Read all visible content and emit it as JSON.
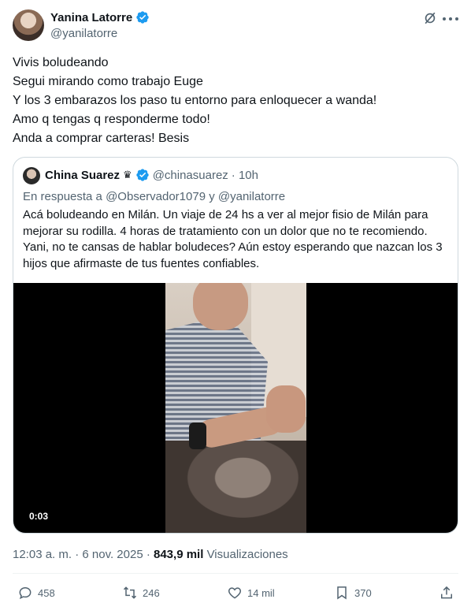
{
  "author": {
    "name": "Yanina Latorre",
    "handle": "@yanilatorre"
  },
  "tweet": {
    "lines": [
      "Vivis boludeando",
      "Segui mirando como trabajo Euge",
      "Y los 3 embarazos los paso tu entorno para enloquecer a wanda!",
      "Amo q tengas q responderme todo!",
      "Anda a comprar carteras! Besis"
    ]
  },
  "quote": {
    "name": "China Suarez",
    "crown": "♛",
    "handle": "@chinasuarez",
    "time": "· 10h",
    "reply_prefix": "En respuesta a",
    "reply_to": "@Observador1079 y @yanilatorre",
    "lines": [
      "Acá boludeando en Milán. Un viaje de 24 hs a ver al mejor fisio de Milán para",
      "mejorar su rodilla. 4 horas de tratamiento con un dolor que no te recomiendo.",
      "Yani, no te cansas de hablar boludeces? Aún estoy esperando que nazcan los 3",
      "hijos que afirmaste de tus fuentes confiables."
    ],
    "video_time": "0:03"
  },
  "meta": {
    "time": "12:03 a. m. · 6 nov. 2025 ·",
    "views_count": "843,9 mil",
    "views_label": "Visualizaciones"
  },
  "actions": {
    "replies": "458",
    "retweets": "246",
    "likes": "14 mil",
    "bookmarks": "370"
  },
  "colors": {
    "verified": "#1d9bf0",
    "secondary_text": "#536471",
    "border": "#cfd9de"
  }
}
